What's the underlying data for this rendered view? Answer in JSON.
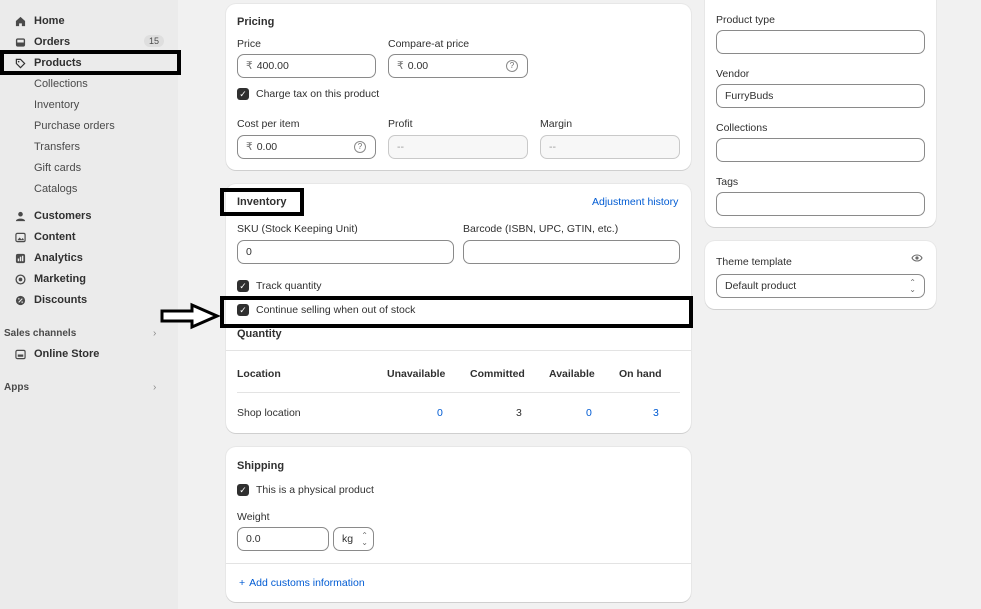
{
  "sidebar": {
    "items": [
      {
        "label": "Home",
        "icon": "home-icon"
      },
      {
        "label": "Orders",
        "icon": "inbox-icon",
        "badge": "15"
      },
      {
        "label": "Products",
        "icon": "tag-icon"
      },
      {
        "label": "Collections"
      },
      {
        "label": "Inventory"
      },
      {
        "label": "Purchase orders"
      },
      {
        "label": "Transfers"
      },
      {
        "label": "Gift cards"
      },
      {
        "label": "Catalogs"
      },
      {
        "label": "Customers",
        "icon": "person-icon"
      },
      {
        "label": "Content",
        "icon": "image-icon"
      },
      {
        "label": "Analytics",
        "icon": "bar-chart-icon"
      },
      {
        "label": "Marketing",
        "icon": "target-icon"
      },
      {
        "label": "Discounts",
        "icon": "discount-icon"
      }
    ],
    "sales_channels": {
      "title": "Sales channels",
      "items": [
        {
          "label": "Online Store",
          "icon": "store-icon"
        }
      ]
    },
    "apps": {
      "title": "Apps"
    }
  },
  "pricing": {
    "title": "Pricing",
    "price_label": "Price",
    "price_currency": "₹",
    "price_value": "400.00",
    "compare_label": "Compare-at price",
    "compare_currency": "₹",
    "compare_value": "0.00",
    "charge_tax_label": "Charge tax on this product",
    "cost_label": "Cost per item",
    "cost_currency": "₹",
    "cost_value": "0.00",
    "profit_label": "Profit",
    "profit_value": "--",
    "margin_label": "Margin",
    "margin_value": "--"
  },
  "inventory": {
    "title": "Inventory",
    "adjustment_link": "Adjustment history",
    "sku_label": "SKU (Stock Keeping Unit)",
    "sku_value": "0",
    "barcode_label": "Barcode (ISBN, UPC, GTIN, etc.)",
    "barcode_value": "",
    "track_label": "Track quantity",
    "continue_label": "Continue selling when out of stock",
    "quantity_title": "Quantity",
    "table": {
      "headers": [
        "Location",
        "Unavailable",
        "Committed",
        "Available",
        "On hand"
      ],
      "rows": [
        {
          "location": "Shop location",
          "unavailable": "0",
          "committed": "3",
          "available": "0",
          "on_hand": "3"
        }
      ]
    }
  },
  "shipping": {
    "title": "Shipping",
    "physical_label": "This is a physical product",
    "weight_label": "Weight",
    "weight_value": "0.0",
    "weight_unit": "kg",
    "customs_link": "Add customs information"
  },
  "organization": {
    "product_type_label": "Product type",
    "product_type_value": "",
    "vendor_label": "Vendor",
    "vendor_value": "FurryBuds",
    "collections_label": "Collections",
    "collections_value": "",
    "tags_label": "Tags",
    "tags_value": ""
  },
  "theme": {
    "title": "Theme template",
    "value": "Default product"
  },
  "colors": {
    "accent_link": "#005bd3",
    "annotation": "#000000"
  }
}
